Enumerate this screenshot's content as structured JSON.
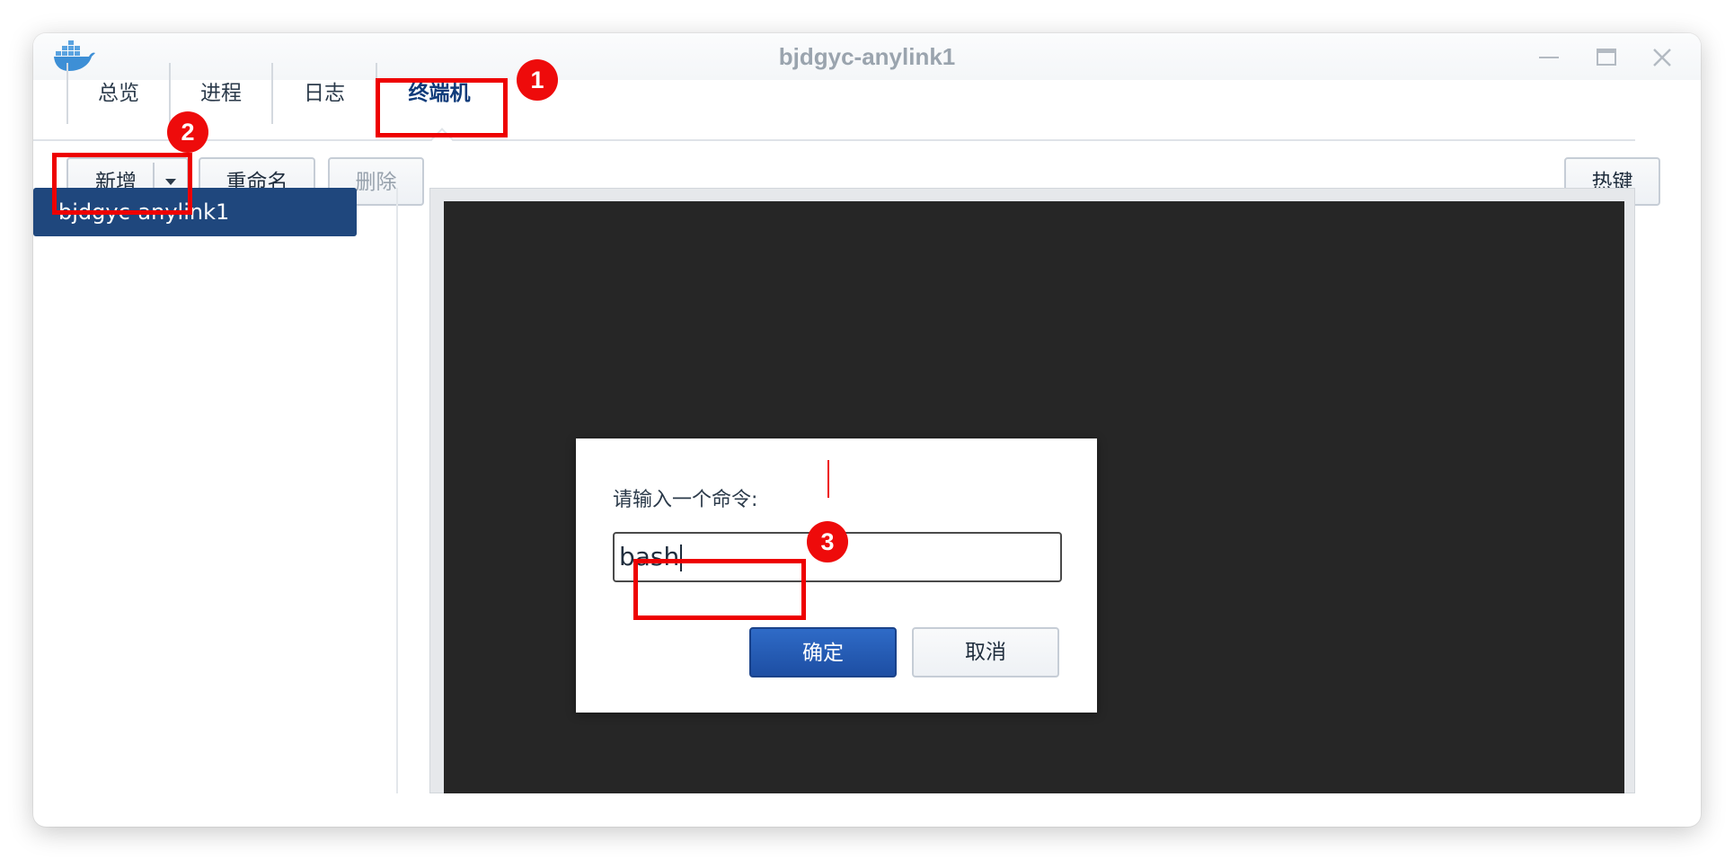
{
  "window": {
    "title": "bjdgyc-anylink1",
    "icon": "docker-whale-icon"
  },
  "tabs": [
    {
      "label": "总览",
      "active": false
    },
    {
      "label": "进程",
      "active": false
    },
    {
      "label": "日志",
      "active": false
    },
    {
      "label": "终端机",
      "active": true
    }
  ],
  "toolbar": {
    "add_label": "新增",
    "rename_label": "重命名",
    "delete_label": "删除",
    "hotkey_label": "热键"
  },
  "terminal_list": {
    "items": [
      {
        "label": "bjdgyc-anylink1",
        "selected": true
      }
    ]
  },
  "dialog": {
    "prompt": "请输入一个命令:",
    "input_value": "bash",
    "ok_label": "确定",
    "cancel_label": "取消"
  },
  "annotations": {
    "badge_1": "1",
    "badge_2": "2",
    "badge_3": "3",
    "color": "#ee0000"
  },
  "colors": {
    "accent": "#1f477d",
    "primary_button": "#2f6bc7",
    "terminal_bg": "#262626",
    "active_tab_text": "#0f3b7a"
  }
}
